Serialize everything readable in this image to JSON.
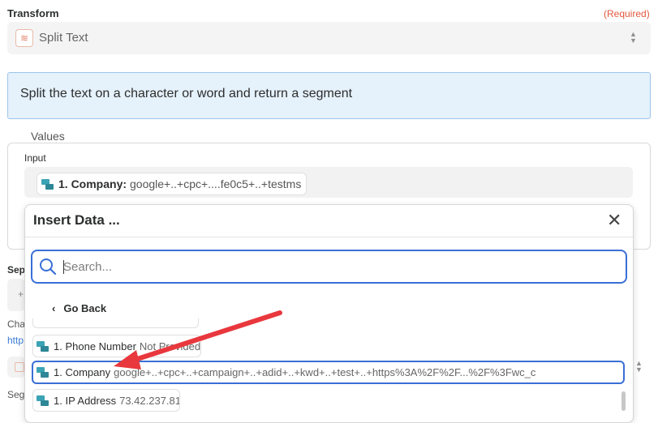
{
  "transform": {
    "label": "Transform",
    "required": "(Required)",
    "app_icon": "split-text-app-icon",
    "selected": "Split Text"
  },
  "info": {
    "text": "Split the text on a character or word and return a segment"
  },
  "values": {
    "legend": "Values",
    "input_label": "Input",
    "input_pill": {
      "key": "1. Company:",
      "value": "google+..+cpc+....fe0c5+..+testms"
    }
  },
  "background_fields": {
    "sep_label": "Sep",
    "sep_plus": "+",
    "cha_label": "Cha",
    "http_link": "http",
    "seg_label": "Seg"
  },
  "insert_popup": {
    "title": "Insert Data ...",
    "search_placeholder": "Search...",
    "go_back": "Go Back",
    "items": [
      {
        "key": "1. Phone Number",
        "value": "Not Provided"
      },
      {
        "key": "1. Company",
        "value": "google+..+cpc+..+campaign+..+adid+..+kwd+..+test+..+https%3A%2F%2F...%2F%3Fwc_c"
      },
      {
        "key": "1. IP Address",
        "value": "73.42.237.81"
      }
    ]
  },
  "colors": {
    "accent": "#3a6fd6",
    "required": "#e2583e",
    "info_bg": "#e5f1fb",
    "annotation_arrow": "#e8383d"
  }
}
